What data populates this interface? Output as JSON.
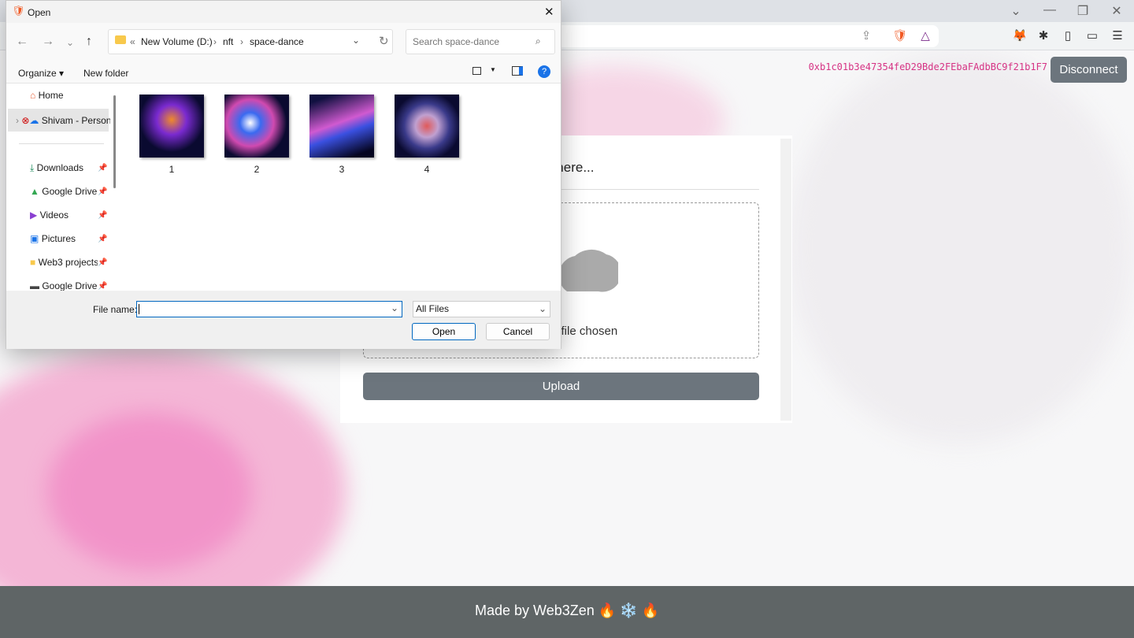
{
  "browser": {
    "wallet_address": "0xb1c01b3e47354feD29Bde2FEbaFAdbBC9f21b1F7",
    "disconnect_label": "Disconnect"
  },
  "page": {
    "drop_heading": "r file here...",
    "no_file_text": "o file chosen",
    "upload_label": "Upload",
    "footer": "Made by Web3Zen 🔥 ❄️ 🔥"
  },
  "dialog": {
    "title": "Open",
    "breadcrumb": [
      "New Volume (D:)",
      "nft",
      "space-dance"
    ],
    "search_placeholder": "Search space-dance",
    "organize_label": "Organize ▾",
    "new_folder_label": "New folder",
    "nav_items": [
      {
        "label": "Home",
        "icon": "home-icon",
        "pinned": false
      },
      {
        "label": "Shivam - Personal",
        "icon": "onedrive-icon",
        "pinned": false
      },
      {
        "label": "Downloads",
        "icon": "download-icon",
        "pinned": true
      },
      {
        "label": "Google Drive",
        "icon": "google-drive-icon",
        "pinned": true
      },
      {
        "label": "Videos",
        "icon": "videos-icon",
        "pinned": true
      },
      {
        "label": "Pictures",
        "icon": "pictures-icon",
        "pinned": true
      },
      {
        "label": "Web3 projects",
        "icon": "folder-icon",
        "pinned": true
      },
      {
        "label": "Google Drive",
        "icon": "drive-icon",
        "pinned": true
      }
    ],
    "files": [
      {
        "name": "1"
      },
      {
        "name": "2"
      },
      {
        "name": "3"
      },
      {
        "name": "4"
      }
    ],
    "file_name_label": "File name:",
    "file_name_value": "",
    "file_type": "All Files",
    "open_label": "Open",
    "cancel_label": "Cancel"
  },
  "colors": {
    "accent_pink": "#d63384",
    "button_gray": "#6c757d",
    "footer": "#5f6566"
  }
}
